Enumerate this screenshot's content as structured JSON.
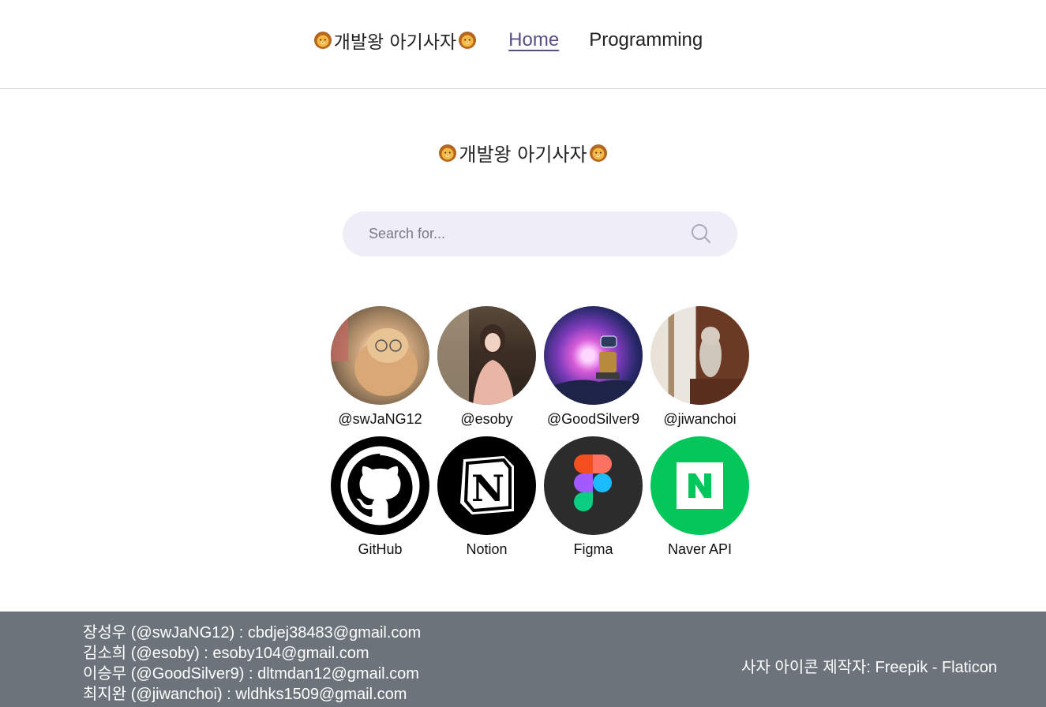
{
  "nav": {
    "brand": "개발왕 아기사자",
    "links": [
      {
        "label": "Home",
        "active": true
      },
      {
        "label": "Programming",
        "active": false
      }
    ]
  },
  "hero": {
    "title": "개발왕 아기사자"
  },
  "search": {
    "placeholder": "Search for...",
    "value": ""
  },
  "members": [
    {
      "handle": "@swJaNG12",
      "avatar": "cat-with-glasses-photo"
    },
    {
      "handle": "@esoby",
      "avatar": "person-photo"
    },
    {
      "handle": "@GoodSilver9",
      "avatar": "walle-robot-photo"
    },
    {
      "handle": "@jiwanchoi",
      "avatar": "cat-on-stairs-photo"
    }
  ],
  "tools": [
    {
      "label": "GitHub",
      "icon": "github-icon",
      "color": "#000000"
    },
    {
      "label": "Notion",
      "icon": "notion-icon",
      "color": "#000000"
    },
    {
      "label": "Figma",
      "icon": "figma-icon",
      "color": "#2c2c2c"
    },
    {
      "label": "Naver API",
      "icon": "naver-icon",
      "color": "#03c75a"
    }
  ],
  "footer": {
    "contacts": [
      "장성우 (@swJaNG12) : cbdjej38483@gmail.com",
      "김소희 (@esoby) : esoby104@gmail.com",
      "이승무 (@GoodSilver9) : dltmdan12@gmail.com",
      "최지완 (@jiwanchoi) : wldhks1509@gmail.com"
    ],
    "credit": "사자 아이콘 제작자: Freepik - Flaticon"
  },
  "colors": {
    "accent": "#5b4e86",
    "search_bg": "#efeef8",
    "footer_bg": "#6c737b"
  }
}
